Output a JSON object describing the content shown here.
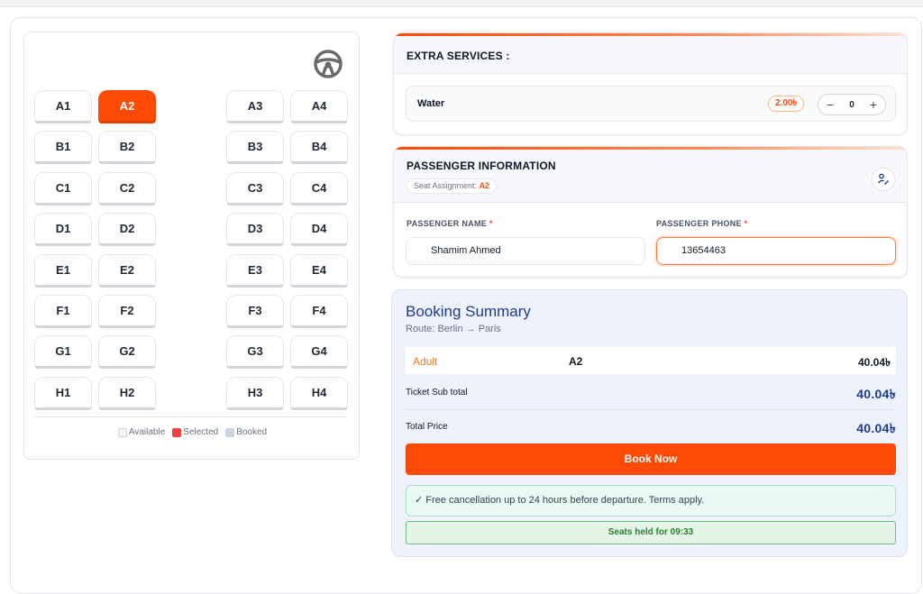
{
  "seat_map": {
    "steering_icon": "steering-wheel-icon",
    "rows": [
      {
        "seats": [
          "A1",
          "A2",
          "A3",
          "A4"
        ]
      },
      {
        "seats": [
          "B1",
          "B2",
          "B3",
          "B4"
        ]
      },
      {
        "seats": [
          "C1",
          "C2",
          "C3",
          "C4"
        ]
      },
      {
        "seats": [
          "D1",
          "D2",
          "D3",
          "D4"
        ]
      },
      {
        "seats": [
          "E1",
          "E2",
          "E3",
          "E4"
        ]
      },
      {
        "seats": [
          "F1",
          "F2",
          "F3",
          "F4"
        ]
      },
      {
        "seats": [
          "G1",
          "G2",
          "G3",
          "G4"
        ]
      },
      {
        "seats": [
          "H1",
          "H2",
          "H3",
          "H4"
        ]
      }
    ],
    "selected": "A2",
    "legend": {
      "available": "Available",
      "selected": "Selected",
      "booked": "Booked"
    }
  },
  "extra_services": {
    "title": "EXTRA SERVICES :",
    "items": [
      {
        "name": "Water",
        "price": "2.00৳",
        "quantity": "0"
      }
    ]
  },
  "passenger": {
    "title": "PASSENGER INFORMATION",
    "seat_assignment_label": "Seat Assignment:",
    "seat_assignment_value": "A2",
    "name_label": "PASSENGER NAME",
    "name_value": "Shamim Ahmed",
    "phone_label": "PASSENGER PHONE",
    "phone_value": "13654463",
    "required_mark": "*"
  },
  "summary": {
    "title": "Booking Summary",
    "route": "Route: Berlin → Paris",
    "adult_label": "Adult",
    "adult_seat": "A2",
    "adult_price": "40.04৳",
    "subtotal_label": "Ticket Sub total",
    "subtotal_value": "40.04৳",
    "total_label": "Total Price",
    "total_value": "40.04৳",
    "book_button": "Book Now",
    "cancellation_note": "Free cancellation up to 24 hours before departure. Terms apply.",
    "hold_text": "Seats held for 09:33"
  },
  "colors": {
    "accent": "#ff4a06",
    "summary_title": "#1f3b8f",
    "selected_legend": "#ef4444",
    "booked_legend": "#cbd5e1"
  }
}
